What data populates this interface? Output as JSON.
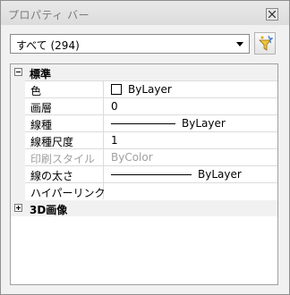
{
  "window": {
    "title": "プロパティ バー"
  },
  "filter": {
    "selected": "すべて (294)"
  },
  "general": {
    "label": "標準",
    "properties": [
      {
        "name": "色",
        "value": "ByLayer"
      },
      {
        "name": "画層",
        "value": "0"
      },
      {
        "name": "線種",
        "value": "ByLayer"
      },
      {
        "name": "線種尺度",
        "value": "1"
      },
      {
        "name": "印刷スタイル",
        "value": "ByColor"
      },
      {
        "name": "線の太さ",
        "value": "ByLayer"
      },
      {
        "name": "ハイパーリンク",
        "value": ""
      }
    ]
  },
  "threed": {
    "label": "3D画像"
  },
  "colors": {
    "color_swatch": "#ffffff",
    "disabled_text": "#a0a0a0"
  }
}
